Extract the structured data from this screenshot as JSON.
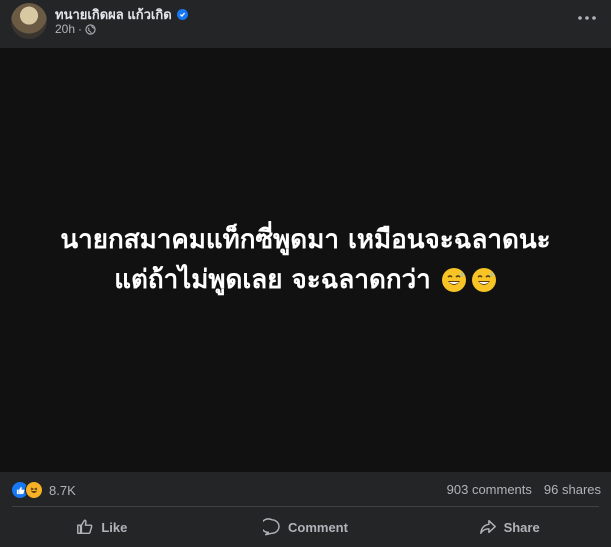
{
  "header": {
    "name": "ทนายเกิดผล แก้วเกิด",
    "time": "20h",
    "separator": "·"
  },
  "post": {
    "line1": "นายกสมาคมแท็กซี่พูดมา เหมือนจะฉลาดนะ",
    "line2": "แต่ถ้าไม่พูดเลย จะฉลาดกว่า"
  },
  "stats": {
    "reaction_count": "8.7K",
    "comments": "903 comments",
    "shares": "96 shares"
  },
  "actions": {
    "like": "Like",
    "comment": "Comment",
    "share": "Share"
  },
  "colors": {
    "background": "#242526",
    "post_background": "#111111",
    "accent": "#1877f2",
    "secondary_text": "#b0b3b8"
  },
  "icons": [
    "verified-badge-icon",
    "globe-icon",
    "more-icon",
    "like-reaction-icon",
    "haha-reaction-icon",
    "sweat-smile-emoji-icon",
    "thumbs-up-icon",
    "comment-icon",
    "share-icon"
  ]
}
